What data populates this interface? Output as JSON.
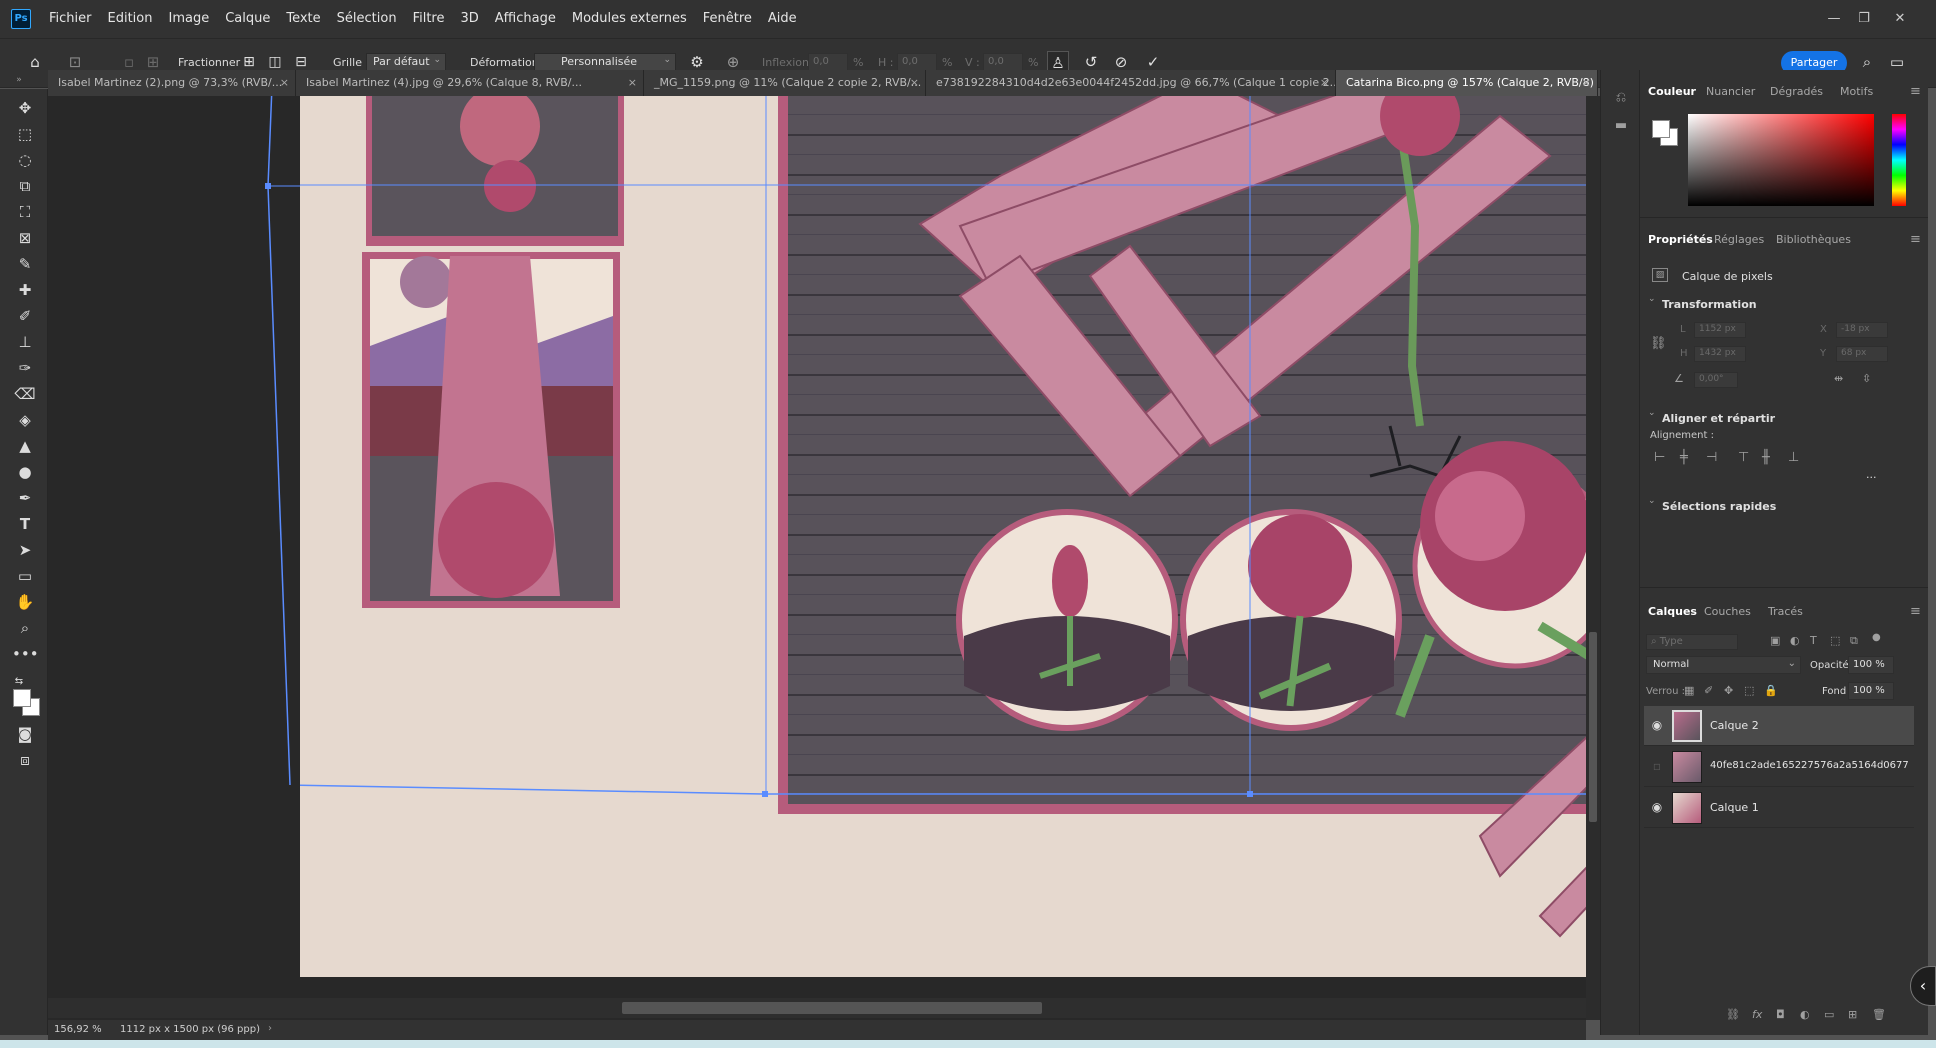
{
  "menu": {
    "logo": "Ps",
    "items": [
      "Fichier",
      "Edition",
      "Image",
      "Calque",
      "Texte",
      "Sélection",
      "Filtre",
      "3D",
      "Affichage",
      "Modules externes",
      "Fenêtre",
      "Aide"
    ],
    "window_controls": [
      "—",
      "❐",
      "⧉",
      "✕"
    ]
  },
  "options": {
    "fractionner_label": "Fractionner :",
    "grille_label": "Grille :",
    "grille_value": "Par défaut",
    "deformation_label": "Déformation :",
    "deformation_value": "Personnalisée",
    "inflexion_label": "Inflexion :",
    "inflexion_value": "0,0",
    "h_label": "H :",
    "h_value": "0,0",
    "v_label": "V :",
    "v_value": "0,0",
    "percent": "%",
    "share_label": "Partager"
  },
  "tabs": [
    {
      "label": "Isabel Martinez (2).png @ 73,3% (RVB/...",
      "active": false
    },
    {
      "label": "Isabel Martinez (4).jpg @ 29,6% (Calque 8, RVB/...",
      "active": false
    },
    {
      "label": "_MG_1159.png @ 11% (Calque 2 copie 2, RVB/...",
      "active": false
    },
    {
      "label": "e738192284310d4d2e63e0044f2452dd.jpg @ 66,7% (Calque 1 copie 2...",
      "active": false
    },
    {
      "label": "Catarina Bico.png @ 157% (Calque 2, RVB/8) *",
      "active": true
    }
  ],
  "status": {
    "zoom": "156,92 %",
    "doc_info": "1112 px x 1500 px (96 ppp)"
  },
  "color_panel": {
    "tabs": [
      "Couleur",
      "Nuancier",
      "Dégradés",
      "Motifs"
    ],
    "fg_color": "#ffffff",
    "bg_color": "#ffffff"
  },
  "properties": {
    "tabs": [
      "Propriétés",
      "Réglages",
      "Bibliothèques"
    ],
    "layer_type": "Calque de pixels",
    "transform_title": "Transformation",
    "w_label": "L",
    "w_value": "1152 px",
    "h_label": "H",
    "h_value": "1432 px",
    "x_label": "X",
    "x_value": "-18 px",
    "y_label": "Y",
    "y_value": "68 px",
    "angle_value": "0,00°",
    "align_title": "Aligner et répartir",
    "align_label": "Alignement :",
    "more": "...",
    "quick_title": "Sélections rapides"
  },
  "layers": {
    "tabs": [
      "Calques",
      "Couches",
      "Tracés"
    ],
    "search_placeholder": "Type",
    "blend_mode": "Normal",
    "opacity_label": "Opacité :",
    "opacity_value": "100 %",
    "lock_label": "Verrou :",
    "fill_label": "Fond :",
    "fill_value": "100 %",
    "items": [
      {
        "name": "Calque 2",
        "visible": true,
        "selected": true
      },
      {
        "name": "40fe81c2ade165227576a2a5164d0677",
        "visible": false,
        "selected": false
      },
      {
        "name": "Calque 1",
        "visible": true,
        "selected": false
      }
    ]
  }
}
